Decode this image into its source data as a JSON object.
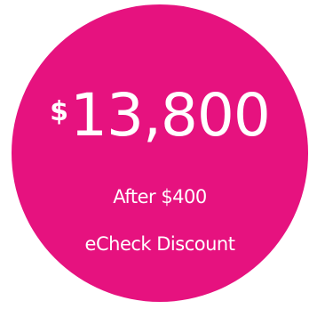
{
  "colors": {
    "badge": "#e6127f",
    "text": "#ffffff"
  },
  "price": {
    "currency": "$",
    "amount": "13,800"
  },
  "caption": {
    "line1": "After $400",
    "line2": "eCheck Discount"
  }
}
